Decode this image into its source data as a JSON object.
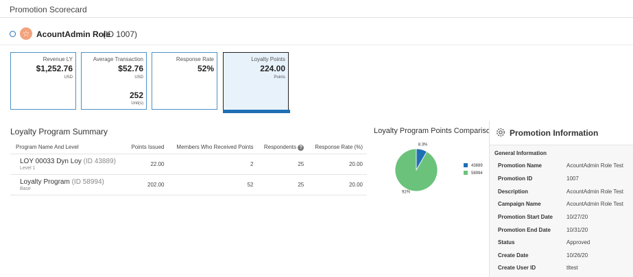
{
  "page": {
    "title": "Promotion Scorecard"
  },
  "role": {
    "name": "AcountAdmin Role",
    "id_text": "(ID 1007)",
    "avatar_icon": "star-icon"
  },
  "metrics": [
    {
      "label": "Revenue LY",
      "value": "$1,252.76",
      "unit": "USD"
    },
    {
      "label": "Average Transaction",
      "value": "$52.76",
      "unit": "USD",
      "value2": "252",
      "unit2": "Unit(s)"
    },
    {
      "label": "Response Rate",
      "value": "52%"
    },
    {
      "label": "Loyalty Points",
      "value": "224.00",
      "unit": "Points",
      "selected": true
    }
  ],
  "summary": {
    "title": "Loyalty Program Summary",
    "columns": [
      "Program Name And Level",
      "Points Issued",
      "Members Who Received Points",
      "Respondents",
      "Response Rate (%)"
    ],
    "rows": [
      {
        "name": "LOY 00033 Dyn Loy",
        "id_text": "(ID 43889)",
        "level": "Level 1",
        "points_issued": "22.00",
        "members": "2",
        "respondents": "25",
        "response_rate": "20.00"
      },
      {
        "name": "Loyalty Program",
        "id_text": "(ID 58994)",
        "level": "Base",
        "points_issued": "202.00",
        "members": "52",
        "respondents": "25",
        "response_rate": "20.00"
      }
    ]
  },
  "chart_data": {
    "type": "pie",
    "title": "Loyalty Program Points Comparison",
    "categories": [
      "43889",
      "58994"
    ],
    "values": [
      8.3,
      91.7
    ],
    "data_labels": [
      "8.3%",
      "92%"
    ],
    "colors": [
      "#1f6fb5",
      "#6bc27b"
    ],
    "legend": "right"
  },
  "info": {
    "title": "Promotion Information",
    "subtitle": "General Information",
    "icon": "gear-icon",
    "fields": [
      {
        "key": "Promotion Name",
        "value": "AcountAdmin Role Test"
      },
      {
        "key": "Promotion ID",
        "value": "1007"
      },
      {
        "key": "Description",
        "value": "AcountAdmin Role Test"
      },
      {
        "key": "Campaign Name",
        "value": "AcountAdmin Role Test"
      },
      {
        "key": "Promotion Start Date",
        "value": "10/27/20"
      },
      {
        "key": "Promotion End Date",
        "value": "10/31/20"
      },
      {
        "key": "Status",
        "value": "Approved"
      },
      {
        "key": "Create Date",
        "value": "10/26/20"
      },
      {
        "key": "Create User ID",
        "value": "tltest"
      }
    ]
  }
}
